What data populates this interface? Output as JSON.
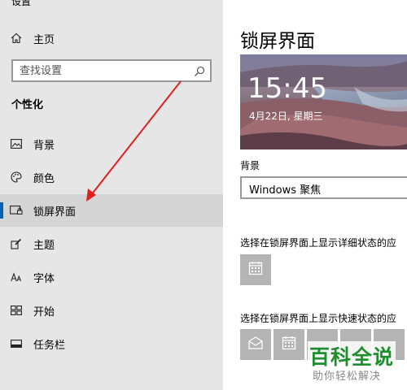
{
  "sidebar": {
    "top_title": "设置",
    "home_label": "主页",
    "search_placeholder": "查找设置",
    "section_title": "个性化",
    "items": [
      {
        "label": "背景"
      },
      {
        "label": "颜色"
      },
      {
        "label": "锁屏界面"
      },
      {
        "label": "主题"
      },
      {
        "label": "字体"
      },
      {
        "label": "开始"
      },
      {
        "label": "任务栏"
      }
    ]
  },
  "main": {
    "title": "锁屏界面",
    "preview_time": "15:45",
    "preview_date": "4月22日, 星期三",
    "background_label": "背景",
    "background_value": "Windows 聚焦",
    "detailed_status_label": "选择在锁屏界面上显示详细状态的应",
    "quick_status_label": "选择在锁屏界面上显示快速状态的应"
  },
  "watermark": {
    "main": "百科全说",
    "sub": "助你轻松解决"
  },
  "colors": {
    "sidebar_bg": "#e6e6e6",
    "selected_bg": "#d5d5d5",
    "accent": "#0063b1",
    "annotation_arrow": "#e02020",
    "tile_bg": "#b4b4b4",
    "watermark_green": "#1e8f2e"
  },
  "icons": {
    "home": "home-icon",
    "search": "search-icon",
    "background": "picture-icon",
    "colors": "palette-icon",
    "lock_screen": "lock-screen-icon",
    "themes": "brush-icon",
    "fonts": "font-icon",
    "start": "start-grid-icon",
    "taskbar": "taskbar-icon",
    "calendar": "calendar-icon",
    "mail": "mail-icon"
  }
}
